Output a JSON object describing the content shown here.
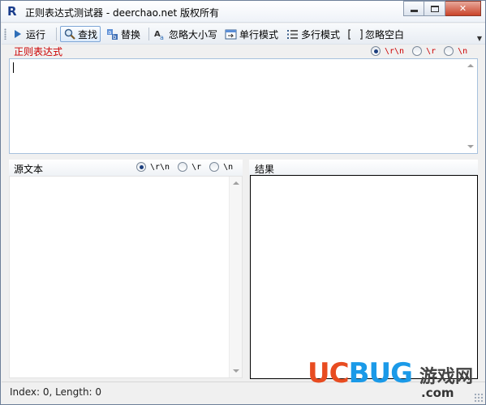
{
  "window": {
    "title": "正则表达式测试器 - deerchao.net 版权所有",
    "app_icon": "R"
  },
  "toolbar": {
    "run": "运行",
    "find": "查找",
    "replace": "替换",
    "ignore_case": "忽略大小写",
    "single_line": "单行模式",
    "multi_line": "多行模式",
    "ignore_space": "忽略空白"
  },
  "regex": {
    "label": "正则表达式",
    "newline_options": [
      "\\r\\n",
      "\\r",
      "\\n"
    ],
    "selected_newline": "\\r\\n"
  },
  "source": {
    "label": "源文本",
    "newline_options": [
      "\\r\\n",
      "\\r",
      "\\n"
    ],
    "selected_newline": "\\r\\n"
  },
  "result": {
    "label": "结果"
  },
  "status": {
    "text": "Index: 0, Length: 0"
  },
  "watermark": {
    "uc": "UC",
    "bug": "BUG",
    "cn": "游戏网",
    "com": ".com"
  },
  "colors": {
    "regex_label": "#cc0000",
    "accent_blue": "#1b9ae8",
    "accent_orange": "#e84c21"
  },
  "icons": {
    "run": "play-icon",
    "find": "magnifier-icon",
    "replace": "replace-icon",
    "ignore_case": "case-icon",
    "single_line": "single-line-icon",
    "multi_line": "multi-line-icon",
    "ignore_space": "bracket-icon"
  }
}
